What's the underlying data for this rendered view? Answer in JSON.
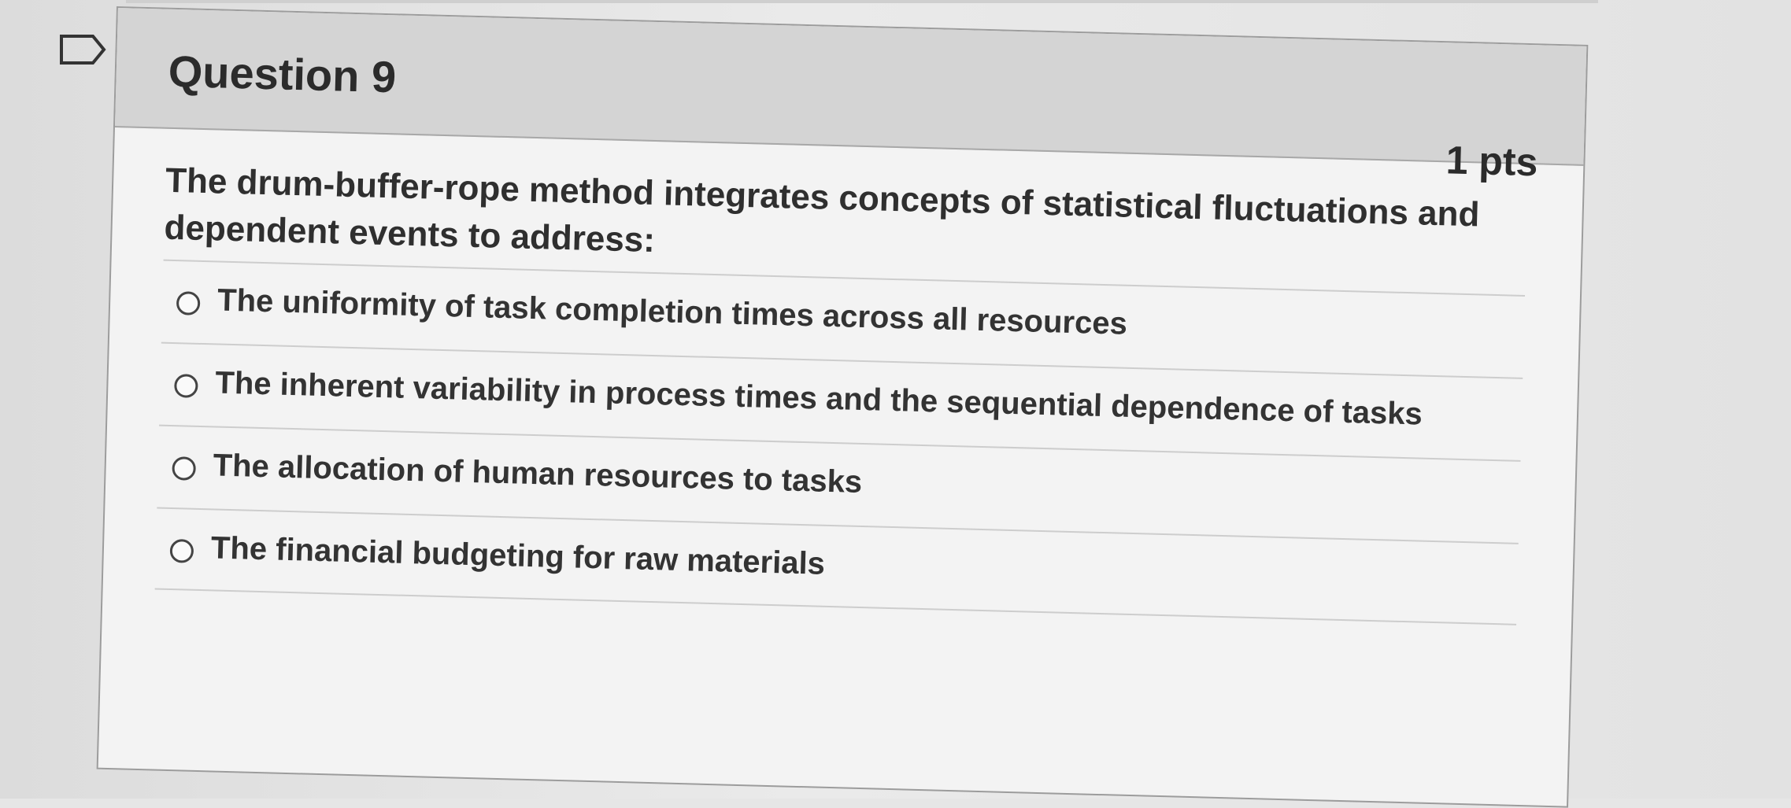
{
  "question": {
    "title": "Question 9",
    "points": "1 pts",
    "prompt": "The drum-buffer-rope method integrates concepts of statistical fluctuations and dependent events to address:",
    "flag_icon": "flag-outline-icon"
  },
  "answers": [
    {
      "label": "The uniformity of task completion times across all resources",
      "selected": false
    },
    {
      "label": "The inherent variability in process times and the sequential dependence of tasks",
      "selected": false
    },
    {
      "label": "The allocation of human resources to tasks",
      "selected": false
    },
    {
      "label": "The financial budgeting for raw materials",
      "selected": false
    }
  ]
}
